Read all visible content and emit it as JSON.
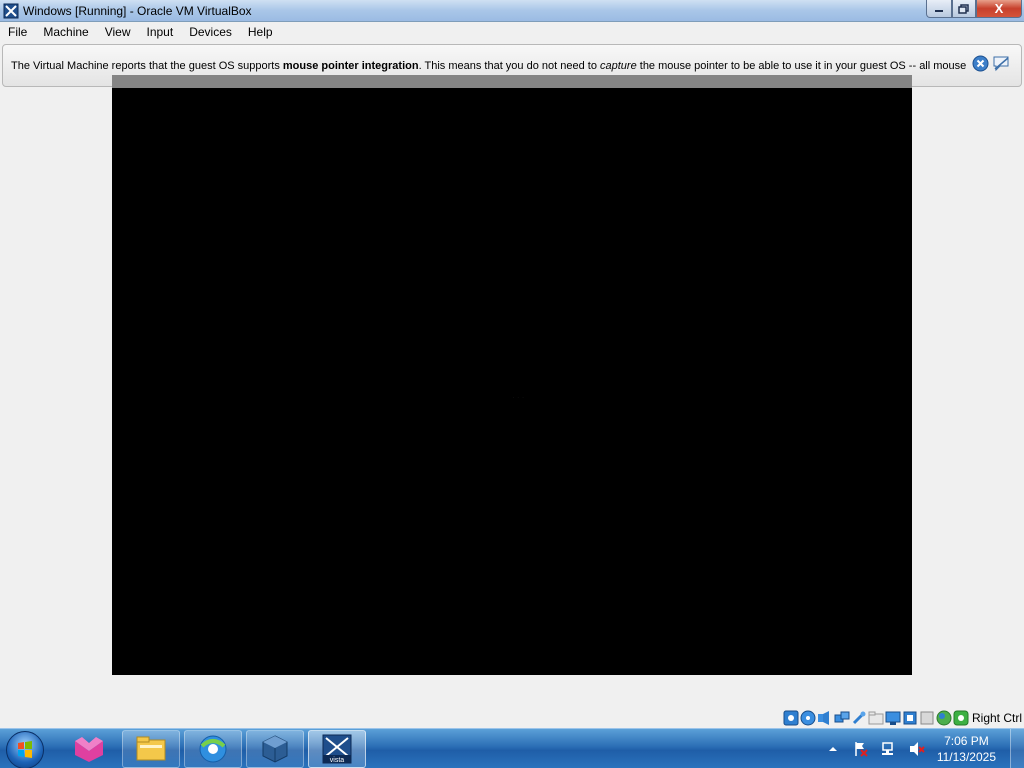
{
  "window": {
    "title": "Windows [Running] - Oracle VM VirtualBox",
    "close_glyph": "X"
  },
  "menu": [
    "File",
    "Machine",
    "View",
    "Input",
    "Devices",
    "Help"
  ],
  "notice": {
    "part1": "The Virtual Machine reports that the guest OS supports ",
    "bold": "mouse pointer integration",
    "part2": ". This means that you do not need to ",
    "italic": "capture",
    "part3": " the mouse pointer to be able to use it in your guest OS -- all mouse"
  },
  "vm": {
    "dots": "· · ·"
  },
  "statusbar": {
    "host_key": "Right Ctrl"
  },
  "taskbar": {
    "apps": [
      "explorer-icon",
      "browser-icon",
      "virtualbox-icon",
      "vista-vm-icon"
    ],
    "vista_label": "vista"
  },
  "clock": {
    "time": "7:06 PM",
    "date": "11/13/2025"
  },
  "colors": {
    "accent": "#2b6eb5",
    "vm_background": "#000000"
  }
}
